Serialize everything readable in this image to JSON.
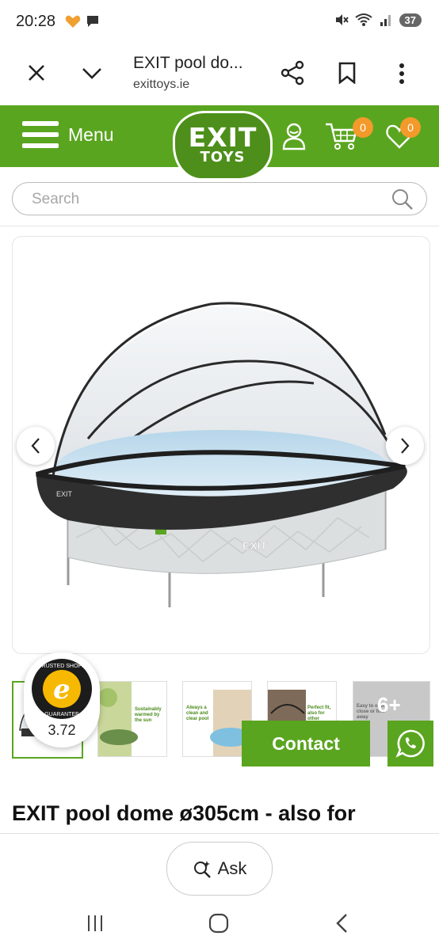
{
  "status_bar": {
    "time": "20:28",
    "battery": "37"
  },
  "browser": {
    "title": "EXIT pool do...",
    "url": "exittoys.ie"
  },
  "header": {
    "menu_label": "Menu",
    "logo_line1": "EXIT",
    "logo_line2": "TOYS",
    "cart_count": "0",
    "wishlist_count": "0"
  },
  "search": {
    "placeholder": "Search"
  },
  "gallery": {
    "thumbnails": [
      {
        "caption": ""
      },
      {
        "caption": "Sustainably warmed by the sun"
      },
      {
        "caption": "Always a clean and clear pool"
      },
      {
        "caption": "Perfect fit, also for other brands"
      },
      {
        "caption": "Easy to open, close or fold away"
      }
    ],
    "more_count": "6+"
  },
  "trusted_shops": {
    "ring_text": "TRUSTED SHOPS · GUARANTEE",
    "letter": "e",
    "score": "3.72"
  },
  "contact": {
    "label": "Contact"
  },
  "product": {
    "title": "EXIT pool dome ø305cm - also for"
  },
  "ask": {
    "label": "Ask"
  },
  "colors": {
    "brand_green": "#5aa51f",
    "badge_orange": "#f39a2b"
  }
}
